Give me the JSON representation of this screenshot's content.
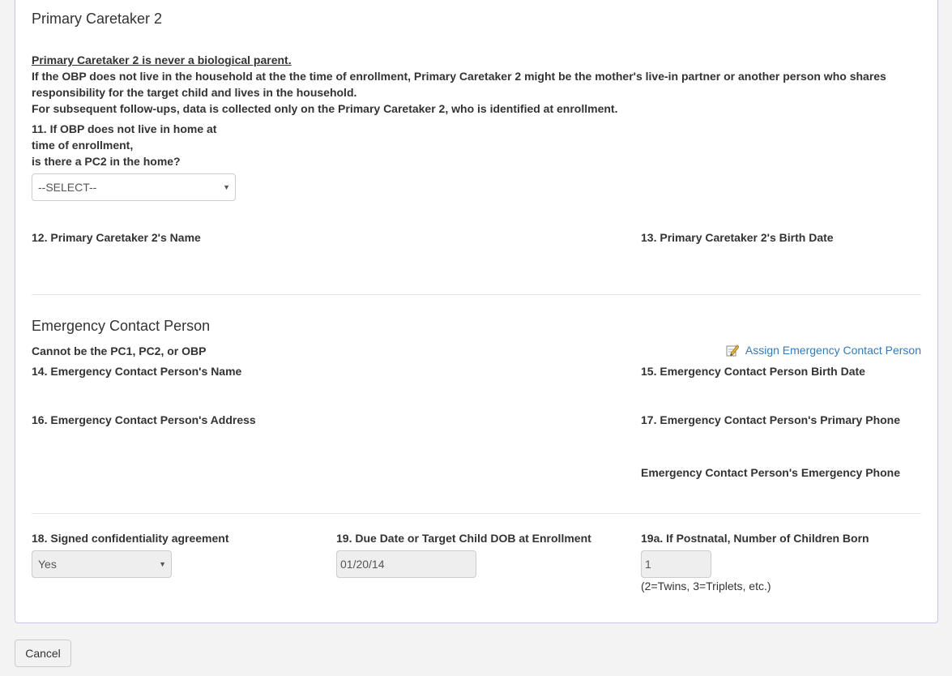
{
  "pc2": {
    "title": "Primary Caretaker 2",
    "note_underline": "Primary Caretaker 2 is never a biological parent.",
    "note_line1": "If the OBP does not live in the household at the the time of enrollment, Primary Caretaker 2 might be the mother's live-in partner or another person who shares",
    "note_line2": "responsibility for the target child and lives in the household.",
    "note_line3": "For subsequent follow-ups, data is collected only on the Primary Caretaker 2, who is identified at enrollment.",
    "q11_line1": "11. If OBP does not live in home at",
    "q11_line2": "time of enrollment,",
    "q11_line3": "is there a PC2 in the home?",
    "q11_value": "--SELECT--",
    "q12_label": "12. Primary Caretaker 2's Name",
    "q13_label": "13. Primary Caretaker 2's Birth Date"
  },
  "emergency": {
    "title": "Emergency Contact Person",
    "subtitle": "Cannot be the PC1, PC2, or OBP",
    "assign_link": "Assign Emergency Contact Person",
    "q14_label": "14. Emergency Contact Person's Name",
    "q15_label": "15. Emergency Contact Person Birth Date",
    "q16_label": "16. Emergency Contact Person's Address",
    "q17_label": "17. Emergency Contact Person's Primary Phone",
    "emergency_phone_label": "Emergency Contact Person's Emergency Phone"
  },
  "enrollment": {
    "q18_label": "18. Signed confidentiality agreement",
    "q18_value": "Yes",
    "q19_label": "19. Due Date or Target Child DOB at Enrollment",
    "q19_value": "01/20/14",
    "q19a_label": "19a. If Postnatal, Number of Children Born",
    "q19a_value": "1",
    "q19a_hint": "(2=Twins, 3=Triplets, etc.)"
  },
  "actions": {
    "cancel_label": "Cancel"
  }
}
